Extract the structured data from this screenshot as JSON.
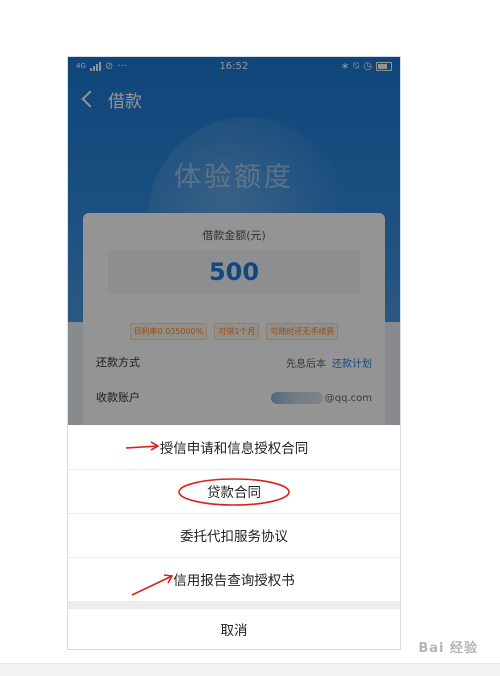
{
  "status_bar": {
    "network": "4G",
    "time": "16:52"
  },
  "nav": {
    "title": "借款"
  },
  "hero": {
    "title": "体验额度"
  },
  "card": {
    "amount_label": "借款金额(元)",
    "amount_value": "500",
    "tags": [
      "日利率0.035000%",
      "可借1个月",
      "可随时还无手续费"
    ],
    "repay_method_label": "还款方式",
    "repay_method_value": "先息后本",
    "repay_plan_link": "还款计划",
    "account_label": "收款账户",
    "account_value": "@qq.com"
  },
  "sheet": {
    "items": [
      "授信申请和信息授权合同",
      "贷款合同",
      "委托代扣服务协议",
      "信用报告查询授权书"
    ],
    "cancel": "取消"
  },
  "colors": {
    "primary_blue": "#1a78d4",
    "accent_orange": "#ff8a2a",
    "annotation_red": "#d9241c"
  },
  "watermark": {
    "text": "Bai 经验"
  }
}
